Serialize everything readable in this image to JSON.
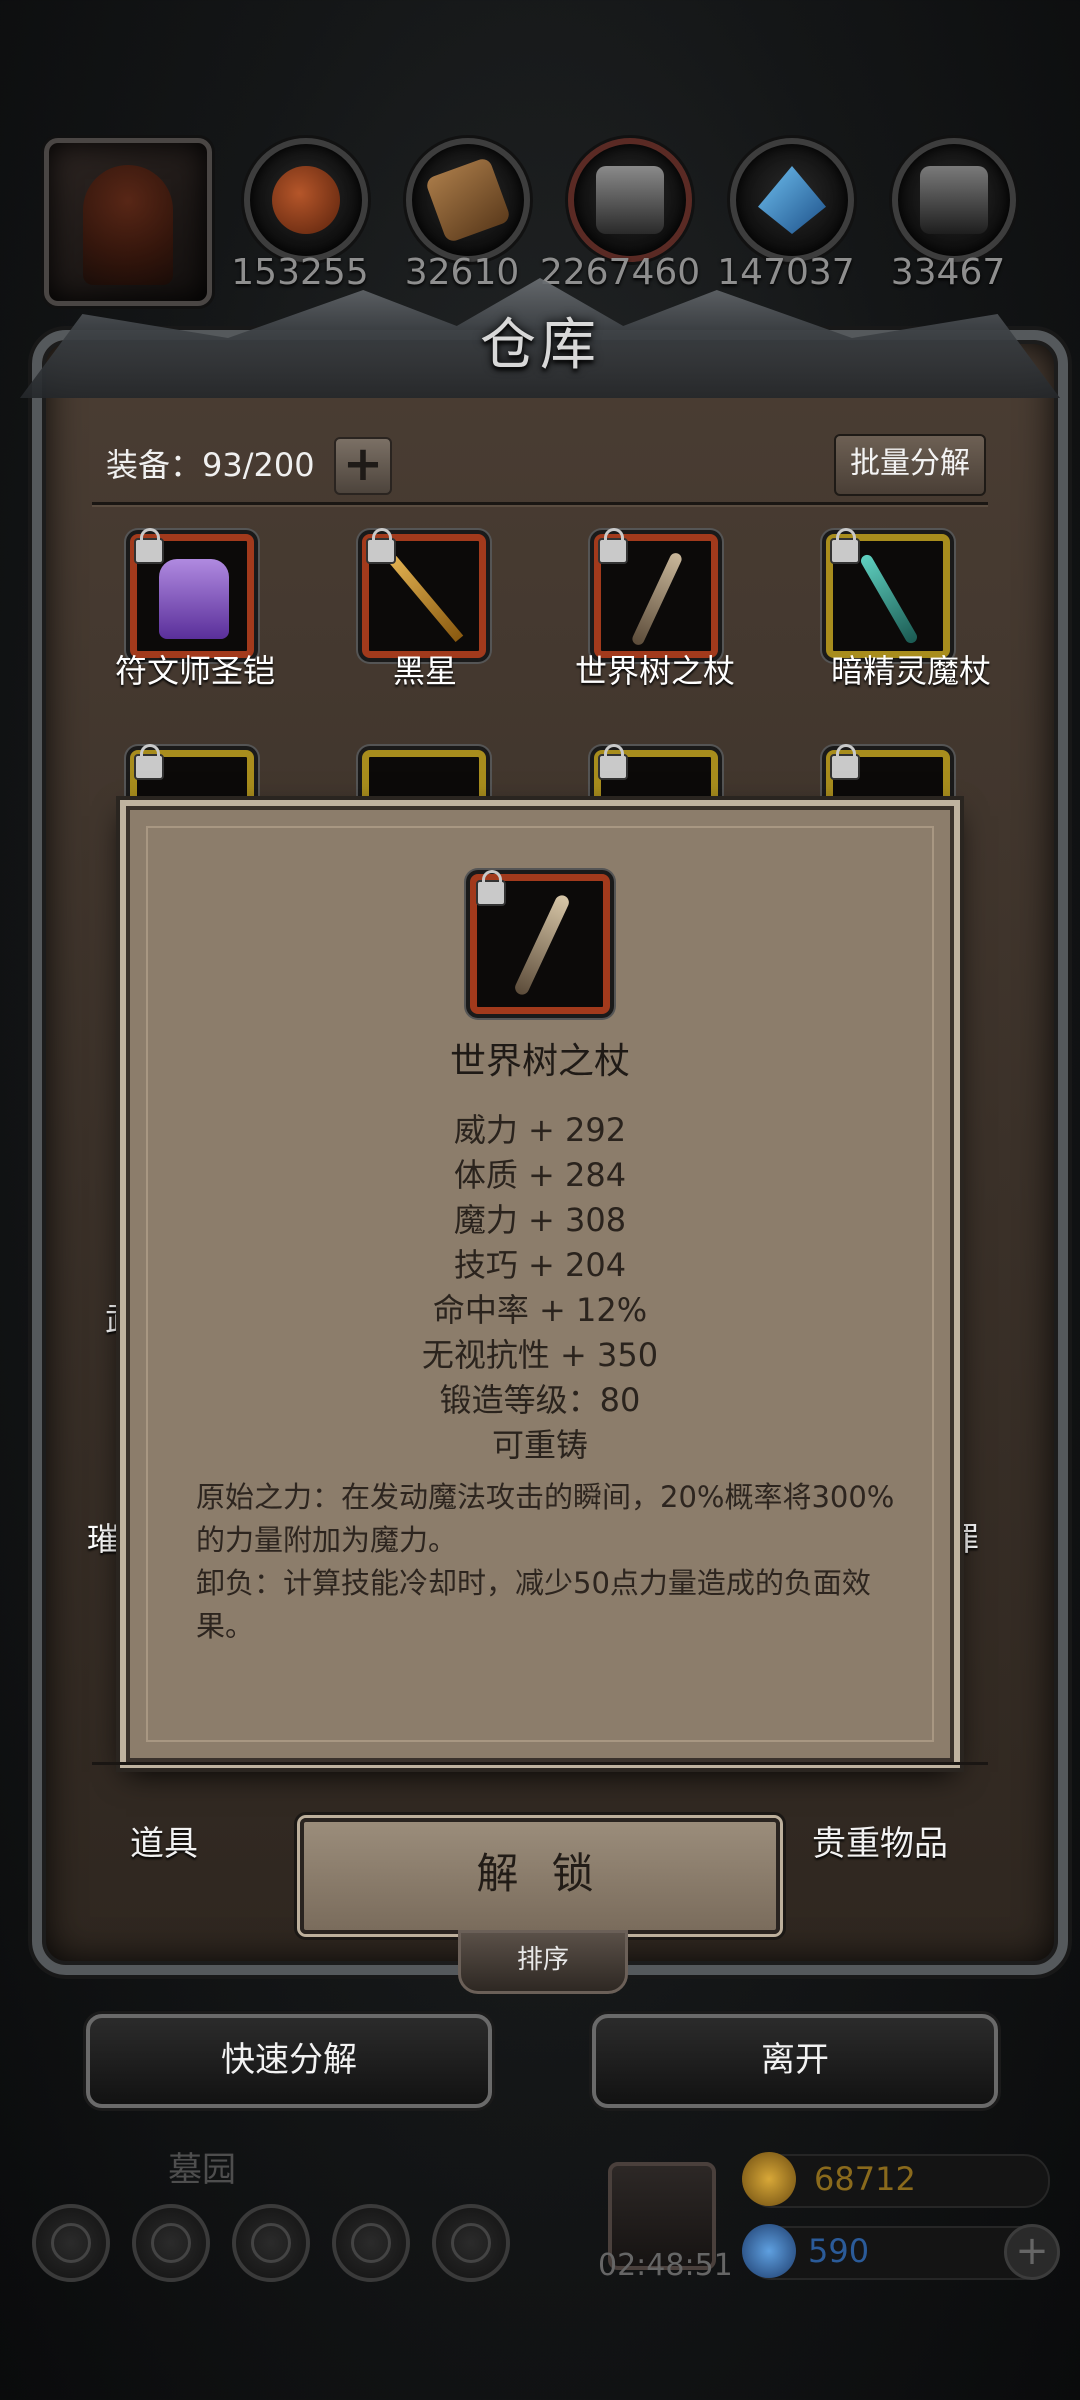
{
  "resources": [
    {
      "name": "leather",
      "value": "153255",
      "icon": "leather-icon",
      "color": "#8a3d1c"
    },
    {
      "name": "wood",
      "value": "32610",
      "icon": "wood-icon",
      "color": "#8a5c32"
    },
    {
      "name": "iron",
      "value": "2267460",
      "icon": "iron-ingot-icon",
      "color": "#777777"
    },
    {
      "name": "crystal",
      "value": "147037",
      "icon": "crystal-icon",
      "color": "#2c6fa8"
    },
    {
      "name": "steel",
      "value": "33467",
      "icon": "steel-ingot-icon",
      "color": "#666666"
    }
  ],
  "warehouse": {
    "title": "仓库",
    "capacity_label": "装备：93/200",
    "add_label": "+",
    "batch_label": "批量分解",
    "items": [
      {
        "name": "符文师圣铠",
        "rarity": "red",
        "icon": "armor-icon"
      },
      {
        "name": "黑星",
        "rarity": "red",
        "icon": "staff-icon"
      },
      {
        "name": "世界树之杖",
        "rarity": "red",
        "icon": "staff-icon"
      },
      {
        "name": "暗精灵魔杖",
        "rarity": "gold",
        "icon": "wand-icon"
      }
    ],
    "partial_labels": [
      "武",
      "璀",
      "罪"
    ]
  },
  "tooltip": {
    "name": "世界树之杖",
    "stats": [
      "威力 + 292",
      "体质 + 284",
      "魔力 + 308",
      "技巧 + 204",
      "命中率 + 12%",
      "无视抗性 + 350",
      "锻造等级：80",
      "可重铸"
    ],
    "description_1": "原始之力：在发动魔法攻击的瞬间，20%概率将300%的力量附加为魔力。",
    "description_2": "卸负：计算技能冷却时，减少50点力量造成的负面效果。"
  },
  "tabs": {
    "left": "道具",
    "right": "贵重物品"
  },
  "unlock_label": "解 锁",
  "sort_label": "排序",
  "actions": {
    "quick_dismantle": "快速分解",
    "leave": "离开"
  },
  "hud": {
    "zone": "墓园",
    "timer": "02:48:51",
    "gold": "68712",
    "gems": "590",
    "plus": "+"
  },
  "colors": {
    "rarity_red": "#a23a1c",
    "rarity_gold": "#a88d1d",
    "rarity_blue": "#2f6aa8",
    "parchment": "#8c7d6b",
    "gold_text": "#8a6a1c",
    "gem_text": "#2b5b99"
  }
}
